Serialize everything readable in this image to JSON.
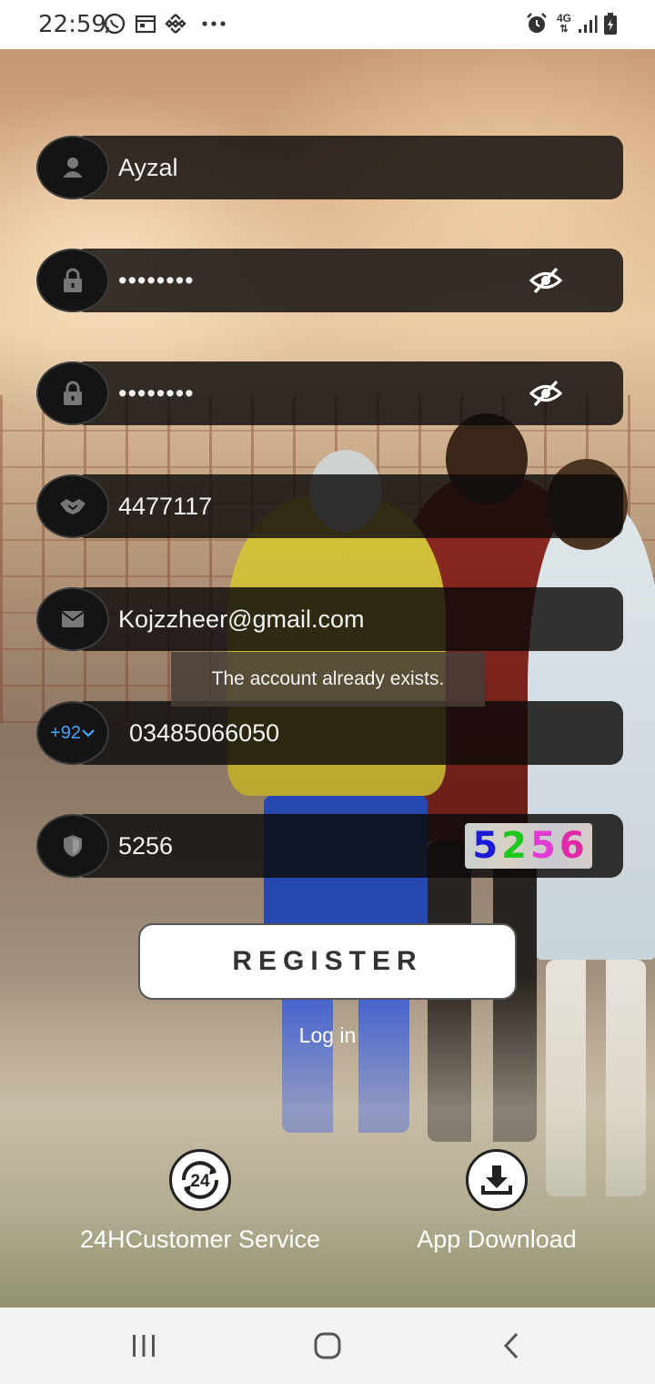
{
  "status_bar": {
    "time": "22:59",
    "icons_left": [
      "whatsapp-icon",
      "calendar-icon",
      "binance-icon",
      "more-dots-icon"
    ],
    "icons_right": [
      "alarm-icon",
      "4g-icon",
      "signal-icon",
      "battery-icon"
    ],
    "network_label": "4G"
  },
  "form": {
    "username": "Ayzal",
    "password_mask": "••••••••",
    "confirm_password_mask": "••••••••",
    "invite_code": "4477117",
    "email": "Kojzzheer@gmail.com",
    "country_code": "+92",
    "phone": "03485066050",
    "captcha_input": "5256",
    "captcha_digits": [
      "5",
      "2",
      "5",
      "6"
    ],
    "captcha_colors": [
      "#1b1bd6",
      "#1ec81e",
      "#e23ad2",
      "#e02aa8"
    ]
  },
  "toast": "The account already exists.",
  "register_label": "REGISTER",
  "login_label": "Log in",
  "bottom": {
    "service_icon_text": "24",
    "service_label": "24HCustomer Service",
    "download_label": "App Download"
  }
}
